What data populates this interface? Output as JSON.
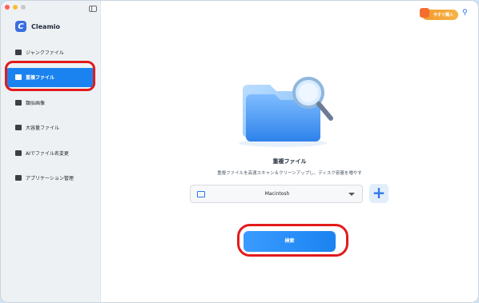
{
  "app": {
    "name": "Cleamio"
  },
  "sidebar": {
    "items": [
      {
        "label": "ジャンクファイル",
        "icon": "broom-icon"
      },
      {
        "label": "重複ファイル",
        "icon": "folder-icon",
        "active": true
      },
      {
        "label": "類似画像",
        "icon": "image-icon"
      },
      {
        "label": "大容量ファイル",
        "icon": "archive-icon"
      },
      {
        "label": "AIでファイル名変更",
        "icon": "ai-folder-icon"
      },
      {
        "label": "アプリケーション管理",
        "icon": "app-icon"
      }
    ]
  },
  "header": {
    "promo_label": "今すぐ購入"
  },
  "main": {
    "title": "重複ファイル",
    "subtitle": "重複ファイルを高速スキャン＆クリーンアップし、ディスク容量を増やす",
    "location": "Macintosh",
    "search_label": "検索"
  },
  "colors": {
    "accent": "#1b83f0",
    "highlight": "#e21b1b",
    "promo": "#f39a2b"
  }
}
